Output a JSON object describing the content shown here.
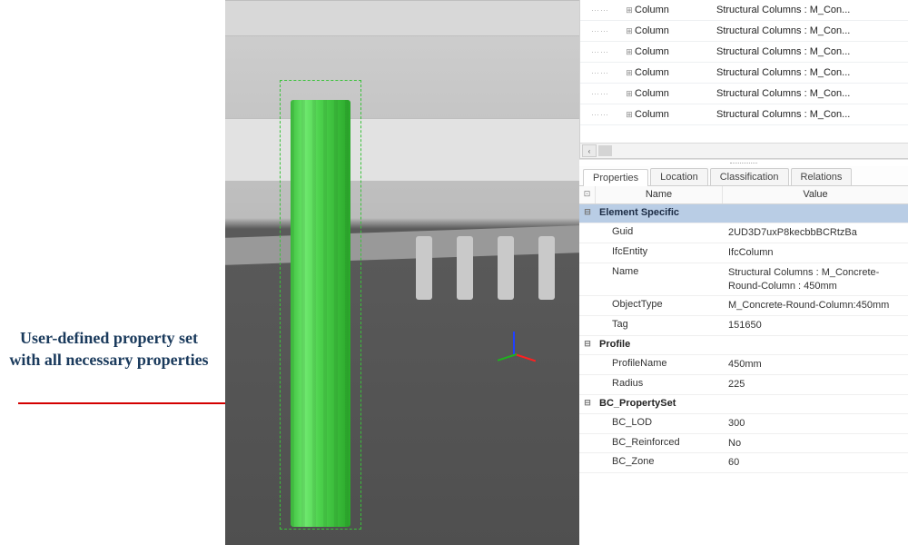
{
  "annotation": {
    "text": "User-defined property set with all necessary properties"
  },
  "tree": {
    "rows": [
      {
        "expander": "⊞",
        "name": "Column",
        "type": "Structural Columns : M_Con..."
      },
      {
        "expander": "⊞",
        "name": "Column",
        "type": "Structural Columns : M_Con..."
      },
      {
        "expander": "⊞",
        "name": "Column",
        "type": "Structural Columns : M_Con..."
      },
      {
        "expander": "⊞",
        "name": "Column",
        "type": "Structural Columns : M_Con..."
      },
      {
        "expander": "⊞",
        "name": "Column",
        "type": "Structural Columns : M_Con..."
      },
      {
        "expander": "⊞",
        "name": "Column",
        "type": "Structural Columns : M_Con..."
      }
    ]
  },
  "tabs": {
    "properties": "Properties",
    "location": "Location",
    "classification": "Classification",
    "relations": "Relations"
  },
  "prop_header": {
    "toggle_icon": "⊡",
    "name": "Name",
    "value": "Value"
  },
  "groups": {
    "element_specific": {
      "label": "Element Specific",
      "toggle": "⊟"
    },
    "profile": {
      "label": "Profile",
      "toggle": "⊟"
    },
    "bc_property_set": {
      "label": "BC_PropertySet",
      "toggle": "⊟"
    }
  },
  "element_specific": {
    "guid_label": "Guid",
    "guid_value": "2UD3D7uxP8kecbbBCRtzBa",
    "ifcentity_label": "IfcEntity",
    "ifcentity_value": "IfcColumn",
    "name_label": "Name",
    "name_value": "Structural Columns : M_Concrete-Round-Column : 450mm",
    "objecttype_label": "ObjectType",
    "objecttype_value": "M_Concrete-Round-Column:450mm",
    "tag_label": "Tag",
    "tag_value": "151650"
  },
  "profile": {
    "profilename_label": "ProfileName",
    "profilename_value": "450mm",
    "radius_label": "Radius",
    "radius_value": "225"
  },
  "bc_property_set": {
    "lod_label": "BC_LOD",
    "lod_value": "300",
    "reinforced_label": "BC_Reinforced",
    "reinforced_value": "No",
    "zone_label": "BC_Zone",
    "zone_value": "60"
  }
}
